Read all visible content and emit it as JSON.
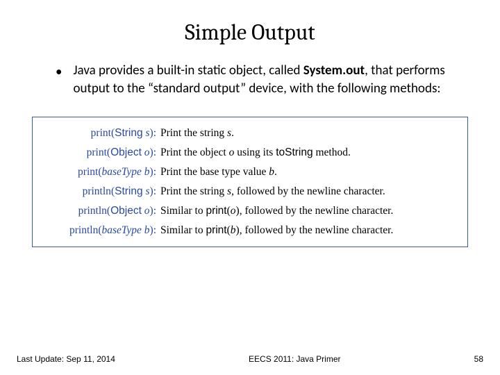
{
  "title": "Simple Output",
  "bullet": {
    "pre": "Java provides a built-in static object, called ",
    "bold": "System.out",
    "post": ", that performs output to the “standard output” device, with the following methods:"
  },
  "methods": [
    {
      "fn": "print",
      "type": "String",
      "typeStyle": "sans",
      "param": "s",
      "desc_pre": "Print the string ",
      "var": "s",
      "desc_post": "."
    },
    {
      "fn": "print",
      "type": "Object",
      "typeStyle": "sans",
      "param": "o",
      "desc_pre": "Print the object ",
      "var": "o",
      "desc_mid": " using its ",
      "sans": "toString",
      "desc_post": " method."
    },
    {
      "fn": "print",
      "type": "baseType",
      "typeStyle": "sc",
      "param": "b",
      "desc_pre": "Print the base type value ",
      "var": "b",
      "desc_post": "."
    },
    {
      "fn": "println",
      "type": "String",
      "typeStyle": "sans",
      "param": "s",
      "desc_pre": "Print the string ",
      "var": "s",
      "desc_post": ", followed by the newline character."
    },
    {
      "fn": "println",
      "type": "Object",
      "typeStyle": "sans",
      "param": "o",
      "desc_pre": "Similar to ",
      "sans": "print",
      "paren_var": "o",
      "desc_post": ", followed by the newline character."
    },
    {
      "fn": "println",
      "type": "baseType",
      "typeStyle": "sc",
      "param": "b",
      "desc_pre": "Similar to ",
      "sans": "print",
      "paren_var": "b",
      "desc_post": ", followed by the newline character."
    }
  ],
  "footer": {
    "left": "Last Update: Sep 11, 2014",
    "center": "EECS 2011: Java Primer",
    "right": "58"
  }
}
